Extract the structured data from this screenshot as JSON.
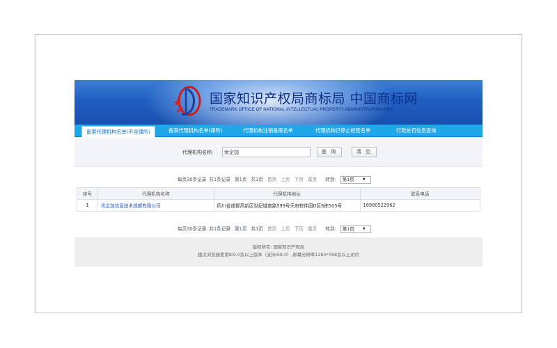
{
  "banner": {
    "title": "国家知识产权局商标局 中国商标网",
    "subtitle": "TRADEMARK OFFICE OF NATIONAL INTELLECTUAL PROPERTY ADMINISTRATION,PRC",
    "accent_color": "#1f5fc2"
  },
  "nav": {
    "items": [
      {
        "label": "备案代理机构名单(不含律所)",
        "active": true
      },
      {
        "label": "备案代理机构名单(律所)",
        "active": false
      },
      {
        "label": "代理机构注销备案名单",
        "active": false
      },
      {
        "label": "代理机构已停止经营名单",
        "active": false
      },
      {
        "label": "行政处罚信息查询",
        "active": false
      }
    ]
  },
  "search": {
    "label": "代理机构名称:",
    "value": "优企加",
    "query_button": "查 询",
    "clear_button": "清 空"
  },
  "pager": {
    "per_page": "每页30条记录",
    "total_pre": "共",
    "total_num": "1",
    "total_post": "条记录",
    "page_pre": "第",
    "page_num": "1",
    "page_post": "页",
    "pages": "共1页",
    "first": "首页",
    "prev": "上页",
    "next": "下页",
    "last": "尾页",
    "goto": "转到:",
    "select_value": "第1页"
  },
  "table": {
    "headers": [
      "序号",
      "代理机构名称",
      "代理机构地址",
      "联系电话"
    ],
    "rows": [
      [
        "1",
        "优企加信息技术成都有限公司",
        "四川省成都高新区世纪城南路599号天府软件园D区6栋505号",
        "18980522962"
      ]
    ]
  },
  "footer": {
    "copyright": "版权所有:  国家知识产权局",
    "browser_note": "建议浏览器使用IE9.0及以上版本（支持IE8.0）,屏幕分辨率1280*768及以上访问"
  }
}
